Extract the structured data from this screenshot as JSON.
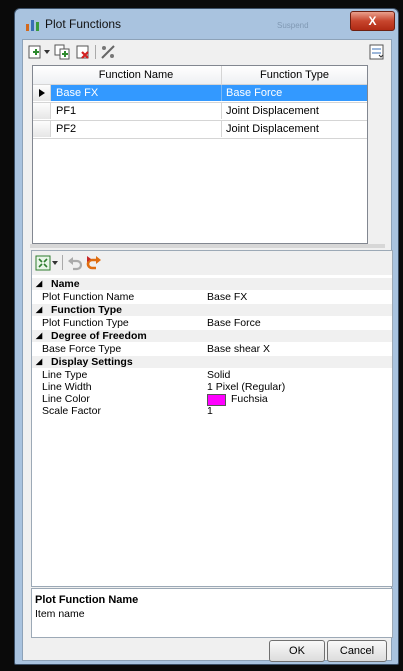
{
  "window": {
    "title": "Plot Functions",
    "ghost_title": "Suspend",
    "close_glyph": "X"
  },
  "toolbar_icons": [
    "add-function-icon",
    "dropdown-arrow-icon",
    "copy-function-icon",
    "delete-function-icon",
    "edit-icon",
    "collapse-icon"
  ],
  "grid": {
    "columns": [
      "Function Name",
      "Function Type"
    ],
    "rows": [
      {
        "name": "Base FX",
        "type": "Base Force",
        "selected": true
      },
      {
        "name": "PF1",
        "type": "Joint Displacement",
        "selected": false
      },
      {
        "name": "PF2",
        "type": "Joint Displacement",
        "selected": false
      }
    ]
  },
  "property_toolbar_icons": [
    "expand-all-icon",
    "undo-icon",
    "redo-icon"
  ],
  "properties": {
    "cat_name": "Name",
    "plot_function_name_label": "Plot Function Name",
    "plot_function_name_value": "Base FX",
    "cat_function_type": "Function Type",
    "plot_function_type_label": "Plot Function Type",
    "plot_function_type_value": "Base Force",
    "cat_dof": "Degree of Freedom",
    "base_force_type_label": "Base Force Type",
    "base_force_type_value": "Base shear X",
    "cat_display": "Display Settings",
    "line_type_label": "Line Type",
    "line_type_value": "Solid",
    "line_width_label": "Line Width",
    "line_width_value": "1 Pixel (Regular)",
    "line_color_label": "Line Color",
    "line_color_value": "Fuchsia",
    "line_color_hex": "#ff00ff",
    "scale_factor_label": "Scale Factor",
    "scale_factor_value": "1"
  },
  "description": {
    "title": "Plot Function Name",
    "text": "Item name"
  },
  "buttons": {
    "ok": "OK",
    "cancel": "Cancel"
  },
  "colors": {
    "selection": "#3399ff",
    "window_frame": "#a9c3df"
  }
}
